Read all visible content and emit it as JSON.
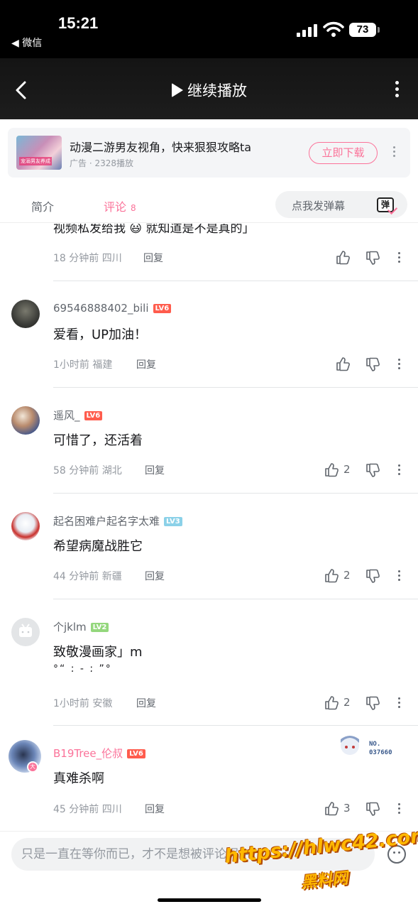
{
  "status_bar": {
    "time": "15:21",
    "back_app": "◀ 微信",
    "battery": "73"
  },
  "header": {
    "resume_label": "继续播放"
  },
  "ad": {
    "title": "动漫二游男友视角，快来狠狠攻略ta",
    "meta": "广告 · 2328播放",
    "button": "立即下载",
    "thumb_text": "宠溺男友养成"
  },
  "tabs": {
    "intro": "简介",
    "comments": "评论",
    "comment_count": "8",
    "danmaku_placeholder": "点我发弹幕",
    "danmaku_icon_text": "弹"
  },
  "partial_comment": {
    "content": "视频私发给我 😃 就知道是不是真的」",
    "time_location": "18 分钟前 四川",
    "reply": "回复"
  },
  "comments": [
    {
      "user": "69546888402_bili",
      "level": "LV6",
      "content": "爱看，UP加油！",
      "time_location": "1小时前 福建",
      "reply": "回复",
      "likes": ""
    },
    {
      "user": "遥风_",
      "level": "LV6",
      "content": "可惜了，还活着",
      "time_location": "58 分钟前 湖北",
      "reply": "回复",
      "likes": "2"
    },
    {
      "user": "起名困难户起名字太难",
      "level": "LV3",
      "content": "希望病魔战胜它",
      "time_location": "44 分钟前 新疆",
      "reply": "回复",
      "likes": "2"
    },
    {
      "user": "个jklm",
      "level": "LV2",
      "content": "致敬漫画家」m",
      "content_line2": "°“ ; - ; ”°",
      "time_location": "1小时前 安徽",
      "reply": "回复",
      "likes": "2"
    },
    {
      "user": "B19Tree_伦叔",
      "level": "LV6",
      "content": "真难杀啊",
      "time_location": "45 分钟前 四川",
      "reply": "回复",
      "likes": "3",
      "badge_label": "NO.",
      "badge_number": "037660"
    }
  ],
  "input": {
    "placeholder": "只是一直在等你而已，才不是想被评论呢～"
  },
  "watermark": {
    "url": "https://hlwc42.com",
    "name": "黑料网"
  },
  "colors": {
    "accent": "#fb7299",
    "lv6": "#ff5c4d",
    "lv3": "#8bd1e8",
    "lv2": "#94d77d",
    "vip_name": "#fb7299"
  }
}
